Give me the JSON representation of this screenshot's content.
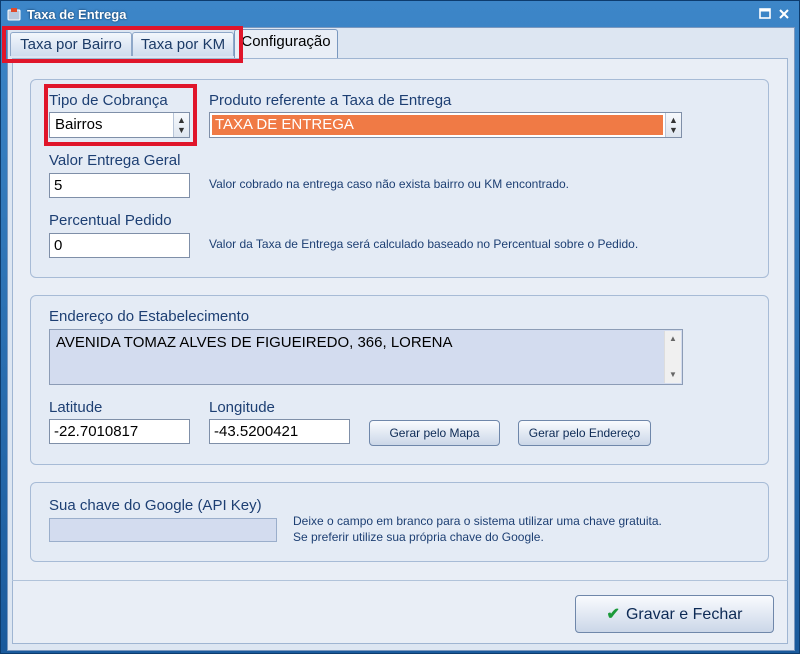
{
  "window": {
    "title": "Taxa de Entrega"
  },
  "tabs": [
    {
      "label": "Taxa por Bairro"
    },
    {
      "label": "Taxa por KM"
    },
    {
      "label": "Configuração"
    }
  ],
  "config": {
    "tipo_cobranca": {
      "label": "Tipo de Cobrança",
      "value": "Bairros"
    },
    "produto": {
      "label": "Produto referente a Taxa de Entrega",
      "value": "TAXA DE ENTREGA",
      "highlight_color": "#f07a45"
    },
    "valor_entrega_geral": {
      "label": "Valor Entrega Geral",
      "value": "5",
      "hint": "Valor cobrado na entrega caso não exista bairro ou KM encontrado."
    },
    "percentual_pedido": {
      "label": "Percentual Pedido",
      "value": "0",
      "hint": "Valor da Taxa de Entrega será calculado baseado no Percentual sobre o Pedido."
    }
  },
  "endereco": {
    "label": "Endereço do Estabelecimento",
    "value": "AVENIDA TOMAZ ALVES DE FIGUEIREDO, 366, LORENA",
    "latitude": {
      "label": "Latitude",
      "value": "-22.7010817"
    },
    "longitude": {
      "label": "Longitude",
      "value": "-43.5200421"
    },
    "btn_mapa": "Gerar pelo Mapa",
    "btn_endereco": "Gerar pelo Endereço"
  },
  "google": {
    "label": "Sua chave do Google (API Key)",
    "value": "",
    "hint": "Deixe o campo em branco para o sistema utilizar uma chave gratuita. Se preferir utilize sua própria chave do Google."
  },
  "footer": {
    "save_label": "Gravar e Fechar"
  },
  "colors": {
    "highlight_red": "#e0152a",
    "title_bar": "#2e75b8"
  }
}
